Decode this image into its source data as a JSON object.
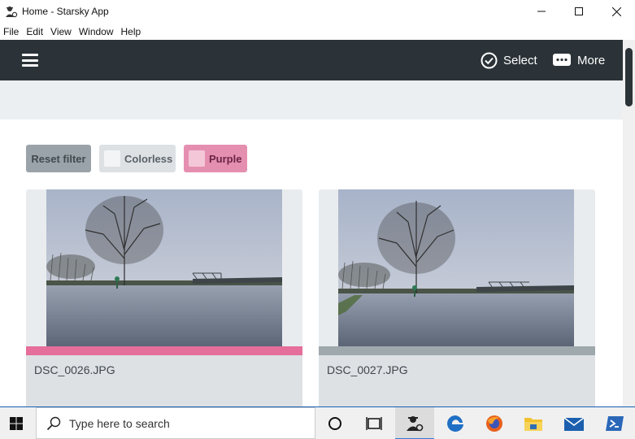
{
  "window": {
    "title": "Home - Starsky App"
  },
  "menu": [
    "File",
    "Edit",
    "View",
    "Window",
    "Help"
  ],
  "header": {
    "select_label": "Select",
    "more_label": "More"
  },
  "filters": {
    "reset_label": "Reset filter",
    "chips": [
      "Colorless",
      "Purple"
    ]
  },
  "cards": [
    {
      "filename": "DSC_0026.JPG",
      "color_tag": "#e56e9a"
    },
    {
      "filename": "DSC_0027.JPG",
      "color_tag": "#9fa8ad"
    }
  ],
  "taskbar": {
    "search_placeholder": "Type here to search"
  },
  "colors": {
    "header": "#2b3338",
    "purple": "#e58fb0",
    "accent": "#2f7ad6"
  }
}
